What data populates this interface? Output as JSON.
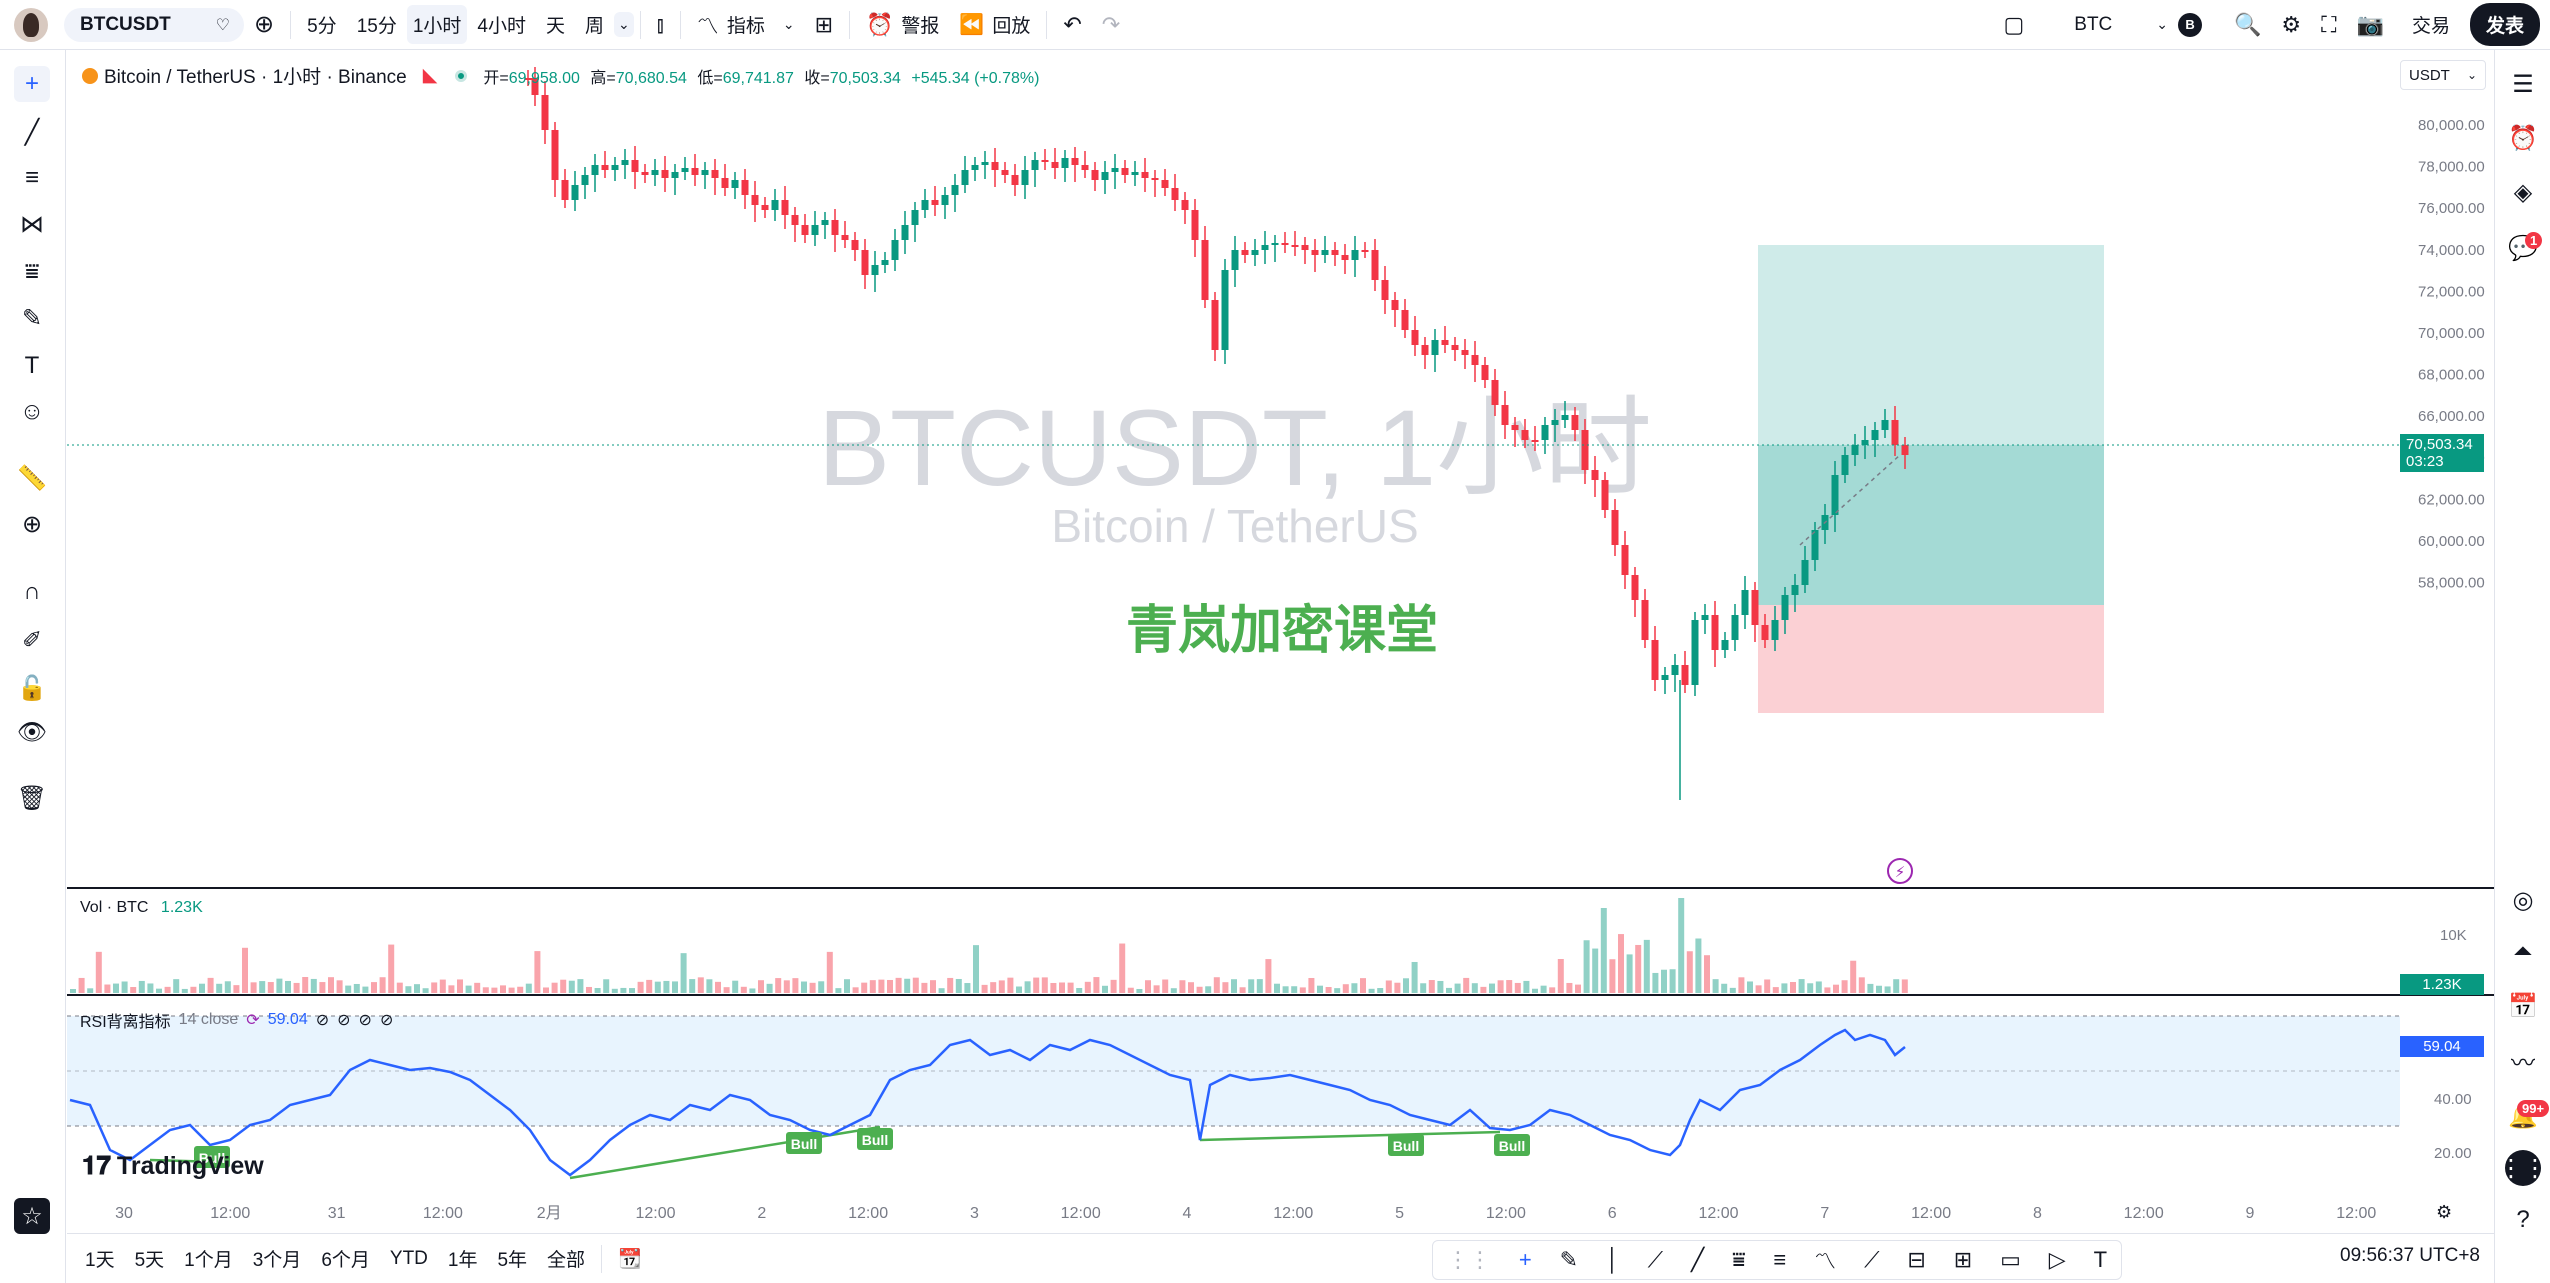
{
  "topbar": {
    "symbol": "BTCUSDT",
    "timeframes": [
      "5分",
      "15分",
      "1小时",
      "4小时",
      "天",
      "周"
    ],
    "active_timeframe": "1小时",
    "indicators_label": "指标",
    "alert_label": "警报",
    "replay_label": "回放",
    "currency": "BTC",
    "currency_badge": "B",
    "trade_label": "交易",
    "publish_label": "发表"
  },
  "legend": {
    "title": "Bitcoin / TetherUS · 1小时 · Binance",
    "open_label": "开=",
    "open": "69,958.00",
    "high_label": "高=",
    "high": "70,680.54",
    "low_label": "低=",
    "low": "69,741.87",
    "close_label": "收=",
    "close": "70,503.34",
    "change": "+545.34 (+0.78%)"
  },
  "watermark": {
    "title": "BTCUSDT, 1小时",
    "subtitle": "Bitcoin / TetherUS",
    "overlay": "青岚加密课堂"
  },
  "price_axis": {
    "currency": "USDT",
    "ticks": [
      "80,000.00",
      "78,000.00",
      "76,000.00",
      "74,000.00",
      "72,000.00",
      "70,000.00",
      "68,000.00",
      "66,000.00",
      "64,000.00",
      "62,000.00",
      "60,000.00",
      "58,000.00"
    ],
    "last_price": "70,503.34",
    "countdown": "03:23"
  },
  "volume": {
    "label": "Vol · BTC",
    "value": "1.23K",
    "axis_tick": "10K",
    "last": "1.23K"
  },
  "rsi": {
    "label": "RSI背离指标",
    "params": "14 close",
    "value": "59.04",
    "axis_ticks": [
      "40.00",
      "20.00"
    ],
    "bull_labels": [
      "Bull",
      "Bull",
      "Bull",
      "Bull",
      "Bull"
    ]
  },
  "time_axis": {
    "labels": [
      "30",
      "12:00",
      "31",
      "12:00",
      "2月",
      "12:00",
      "2",
      "12:00",
      "3",
      "12:00",
      "4",
      "12:00",
      "5",
      "12:00",
      "6",
      "12:00",
      "7",
      "12:00",
      "8",
      "12:00",
      "9",
      "12:00"
    ]
  },
  "bottombar": {
    "ranges": [
      "1天",
      "5天",
      "1个月",
      "3个月",
      "6个月",
      "YTD",
      "1年",
      "5年",
      "全部"
    ],
    "clock": "09:56:37 UTC+8"
  },
  "branding": {
    "logo": "TradingView"
  },
  "right_badges": {
    "chat": "1",
    "notifications": "99+"
  },
  "colors": {
    "up": "#089981",
    "down": "#f23645",
    "rsi_line": "#2962ff",
    "bull": "#4caf50",
    "long_profit": "#26a69a",
    "long_loss": "#f7a9b1"
  }
}
